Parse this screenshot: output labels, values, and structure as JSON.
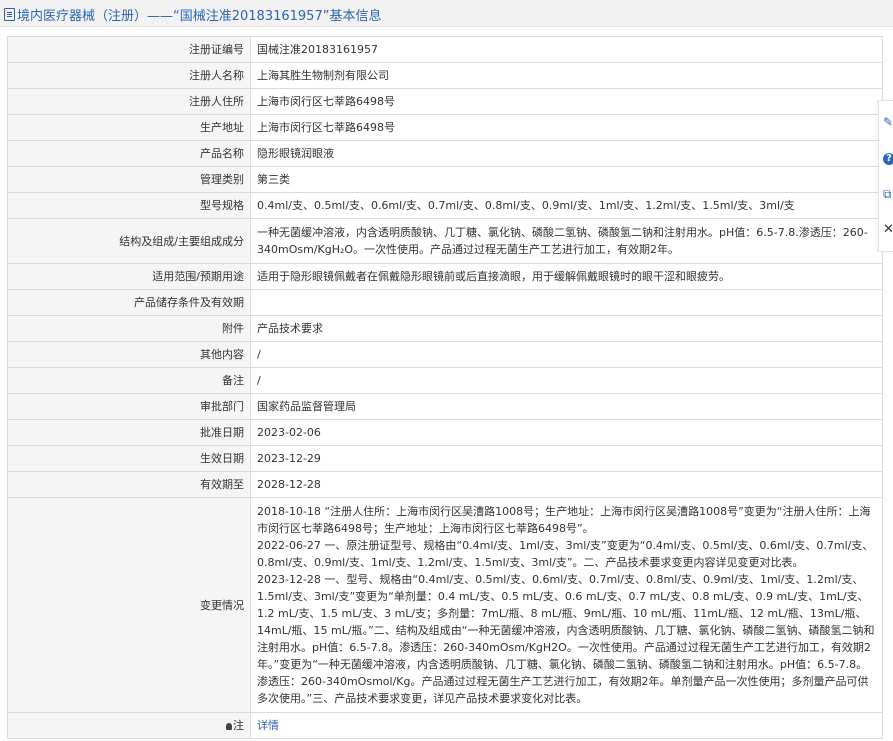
{
  "header": {
    "title": "境内医疗器械（注册）——“国械注准20183161957”基本信息"
  },
  "rows": [
    {
      "label": "注册证编号",
      "value": "国械注准20183161957"
    },
    {
      "label": "注册人名称",
      "value": "上海其胜生物制剂有限公司"
    },
    {
      "label": "注册人住所",
      "value": "上海市闵行区七莘路6498号"
    },
    {
      "label": "生产地址",
      "value": "上海市闵行区七莘路6498号"
    },
    {
      "label": "产品名称",
      "value": "隐形眼镜润眼液"
    },
    {
      "label": "管理类别",
      "value": "第三类"
    },
    {
      "label": "型号规格",
      "value": "0.4ml/支、0.5ml/支、0.6ml/支、0.7ml/支、0.8ml/支、0.9ml/支、1ml/支、1.2ml/支、1.5ml/支、3ml/支"
    },
    {
      "label": "结构及组成/主要组成成分",
      "value": "一种无菌缓冲溶液，内含透明质酸钠、几丁糖、氯化钠、磷酸二氢钠、磷酸氢二钠和注射用水。pH值：6.5-7.8.渗透压：260-340mOsm/KgH₂O。一次性使用。产品通过过程无菌生产工艺进行加工，有效期2年。"
    },
    {
      "label": "适用范围/预期用途",
      "value": "适用于隐形眼镜佩戴者在佩戴隐形眼镜前或后直接滴眼，用于缓解佩戴眼镜时的眼干涩和眼疲劳。"
    },
    {
      "label": "产品储存条件及有效期",
      "value": ""
    },
    {
      "label": "附件",
      "value": "产品技术要求"
    },
    {
      "label": "其他内容",
      "value": "/"
    },
    {
      "label": "备注",
      "value": "/"
    },
    {
      "label": "审批部门",
      "value": "国家药品监督管理局"
    },
    {
      "label": "批准日期",
      "value": "2023-02-06"
    },
    {
      "label": "生效日期",
      "value": "2023-12-29"
    },
    {
      "label": "有效期至",
      "value": "2028-12-28"
    }
  ],
  "change": {
    "label": "变更情况",
    "entries": [
      "2018-10-18 “注册人住所：上海市闵行区吴漕路1008号；生产地址：上海市闵行区吴漕路1008号”变更为“注册人住所：上海市闵行区七莘路6498号；生产地址：上海市闵行区七莘路6498号”。",
      "2022-06-27 一、原注册证型号、规格由“0.4ml/支、1ml/支、3ml/支”变更为“0.4ml/支、0.5ml/支、0.6ml/支、0.7ml/支、0.8ml/支、0.9ml/支、1ml/支、1.2ml/支、1.5ml/支、3ml/支”。二、产品技术要求变更内容详见变更对比表。",
      "2023-12-28 一、型号、规格由“0.4ml/支、0.5ml/支、0.6ml/支、0.7ml/支、0.8ml/支、0.9ml/支、1ml/支、1.2ml/支、1.5ml/支、3ml/支”变更为“单剂量：0.4 mL/支、0.5 mL/支、0.6 mL/支、0.7 mL/支、0.8 mL/支、0.9 mL/支、1mL/支、1.2 mL/支、1.5 mL/支、3 mL/支；多剂量：7mL/瓶、8 mL/瓶、9mL/瓶、10 mL/瓶、11mL/瓶、12 mL/瓶、13mL/瓶、14mL/瓶、15 mL/瓶。”二、结构及组成由“一种无菌缓冲溶液，内含透明质酸钠、几丁糖、氯化钠、磷酸二氢钠、磷酸氢二钠和注射用水。pH值：6.5-7.8。渗透压：260-340mOsm/KgH2O。一次性使用。产品通过过程无菌生产工艺进行加工，有效期2年。”变更为“一种无菌缓冲溶液，内含透明质酸钠、几丁糖、氯化钠、磷酸二氢钠、磷酸氢二钠和注射用水。pH值：6.5-7.8。渗透压：260-340mOsmol/Kg。产品通过过程无菌生产工艺进行加工，有效期2年。单剂量产品一次性使用；多剂量产品可供多次使用。”三、产品技术要求变更，详见产品技术要求变化对比表。"
    ]
  },
  "note": {
    "label": "注",
    "link_text": "详情"
  },
  "side_tools": {
    "edit_glyph": "✎",
    "help_glyph": "?",
    "copy_glyph": "⧉",
    "close_glyph": "✕"
  }
}
